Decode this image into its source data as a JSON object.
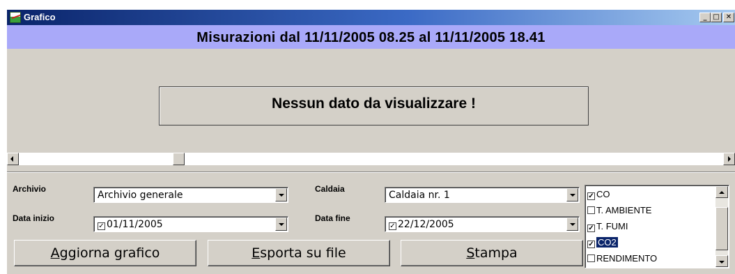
{
  "window": {
    "title": "Grafico",
    "minimize": "_",
    "maximize": "□",
    "close": "✕"
  },
  "header": {
    "text": "Misurazioni dal 11/11/2005 08.25 al 11/11/2005 18.41"
  },
  "chart_area": {
    "message": "Nessun dato da visualizzare !"
  },
  "form": {
    "archivio_label": "Archivio",
    "archivio_value": "Archivio generale",
    "caldaia_label": "Caldaia",
    "caldaia_value": "Caldaia nr. 1",
    "data_inizio_label": "Data inizio",
    "data_inizio_value": "01/11/2005",
    "data_inizio_checked": true,
    "data_fine_label": "Data fine",
    "data_fine_value": "22/12/2005",
    "data_fine_checked": true
  },
  "buttons": {
    "aggiorna_underline": "A",
    "aggiorna_rest": "ggiorna grafico",
    "esporta_underline": "E",
    "esporta_rest": "sporta su file",
    "stampa_underline": "S",
    "stampa_rest": "tampa"
  },
  "series_list": {
    "items": [
      {
        "label": "CO",
        "checked": true,
        "selected": false
      },
      {
        "label": "T. AMBIENTE",
        "checked": false,
        "selected": false
      },
      {
        "label": "T. FUMI",
        "checked": true,
        "selected": false
      },
      {
        "label": "CO2",
        "checked": true,
        "selected": true
      },
      {
        "label": "RENDIMENTO",
        "checked": false,
        "selected": false
      }
    ]
  },
  "colors": {
    "title_bar": "#0a246a",
    "header_band": "#a9a9f9",
    "face": "#d4d0c8",
    "selection": "#0a246a"
  },
  "icons": {
    "app": "chart-icon",
    "checkbox_checked": "✓"
  }
}
